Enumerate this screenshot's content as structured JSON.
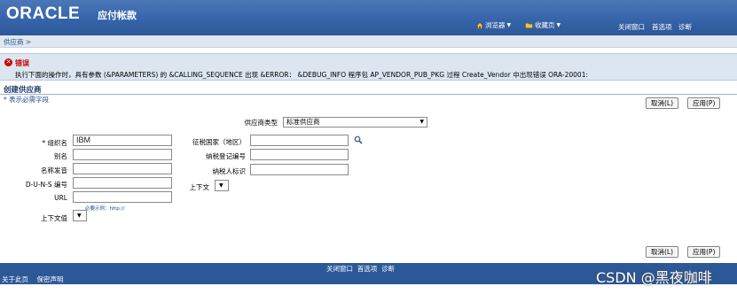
{
  "header": {
    "brand": "ORACLE",
    "app_title": "应付帐款",
    "browser_label": "浏览器",
    "favorites_label": "收藏页",
    "close_window": "关闭窗口",
    "preferences": "首选项",
    "diagnostics": "诊断"
  },
  "breadcrumb": "供应商 >",
  "error": {
    "title": "错误",
    "message": "执行下面的操作时，具有参数 (&PARAMETERS) 的 &CALLING_SEQUENCE 出现 &ERROR： &DEBUG_INFO 程序包 AP_VENDOR_PUB_PKG 过程 Create_Vendor 中出现错误 ORA-20001:"
  },
  "page": {
    "title": "创建供应商",
    "required_note": "* 表示必需字段"
  },
  "buttons": {
    "cancel": "取消(L)",
    "apply": "应用(P)"
  },
  "form": {
    "supplier_type_label": "供应商类型",
    "supplier_type_value": "标准供应商",
    "org_name_label": "* 组织名",
    "org_name_value": "IBM",
    "alias_label": "别名",
    "name_pronunciation_label": "名称发音",
    "duns_label": "D-U-N-S 编号",
    "url_label": "URL",
    "url_example": "必要示例：http://",
    "context_value_label": "上下文值",
    "tax_country_label": "征税国家（地区）",
    "tax_reg_label": "纳税登记编号",
    "taxpayer_id_label": "纳税人标识",
    "context_label": "上下文"
  },
  "footer": {
    "close_window": "关闭窗口",
    "preferences": "首选项",
    "diagnostics": "诊断",
    "about": "关于此页",
    "privacy": "保密声明"
  },
  "watermark": "CSDN @黑夜咖啡",
  "colors": {
    "header_blue": "#3563a8",
    "error_red": "#cc0000",
    "error_bg": "#dbe6f0"
  }
}
